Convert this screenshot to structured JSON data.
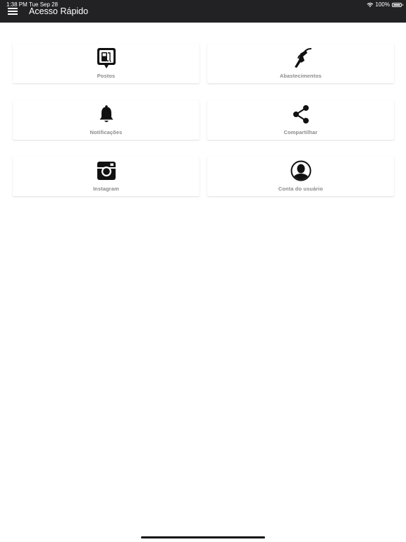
{
  "status_bar": {
    "time": "1:38 PM",
    "date": "Tue Sep 28",
    "battery": "100%"
  },
  "header": {
    "title": "Acesso Rápido"
  },
  "colors": {
    "topbar": "#222124",
    "label": "#8a8a8a",
    "icon": "#111111"
  },
  "cards": [
    {
      "label": "Postos",
      "icon": "fuel-station-pin-icon"
    },
    {
      "label": "Abastecimentos",
      "icon": "fuel-nozzle-icon"
    },
    {
      "label": "Notificações",
      "icon": "bell-icon"
    },
    {
      "label": "Compartilhar",
      "icon": "share-icon"
    },
    {
      "label": "Instagram",
      "icon": "instagram-icon"
    },
    {
      "label": "Conta do usuário",
      "icon": "user-account-icon"
    }
  ]
}
